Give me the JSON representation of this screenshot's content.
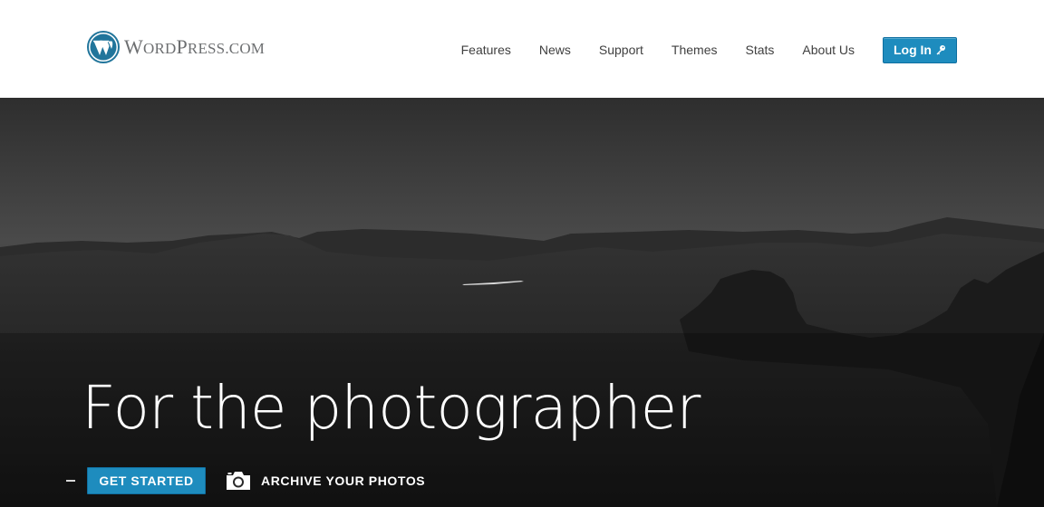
{
  "brand": {
    "name_big1": "W",
    "name_small1": "ORD",
    "name_big2": "P",
    "name_small2": "RESS",
    "name_suffix": ".COM"
  },
  "nav": {
    "items": [
      "Features",
      "News",
      "Support",
      "Themes",
      "Stats",
      "About Us"
    ],
    "login_label": "Log In"
  },
  "hero": {
    "headline": "For the photographer",
    "cta_label": "GET STARTED",
    "secondary_label": "ARCHIVE YOUR PHOTOS"
  },
  "colors": {
    "accent": "#1e8cbe",
    "nav_text": "#404040",
    "logo_text": "#6d6f71",
    "hero_bg": "#242424"
  },
  "icons": {
    "logo": "wordpress-logo-icon",
    "login": "key-icon",
    "camera": "camera-icon"
  }
}
